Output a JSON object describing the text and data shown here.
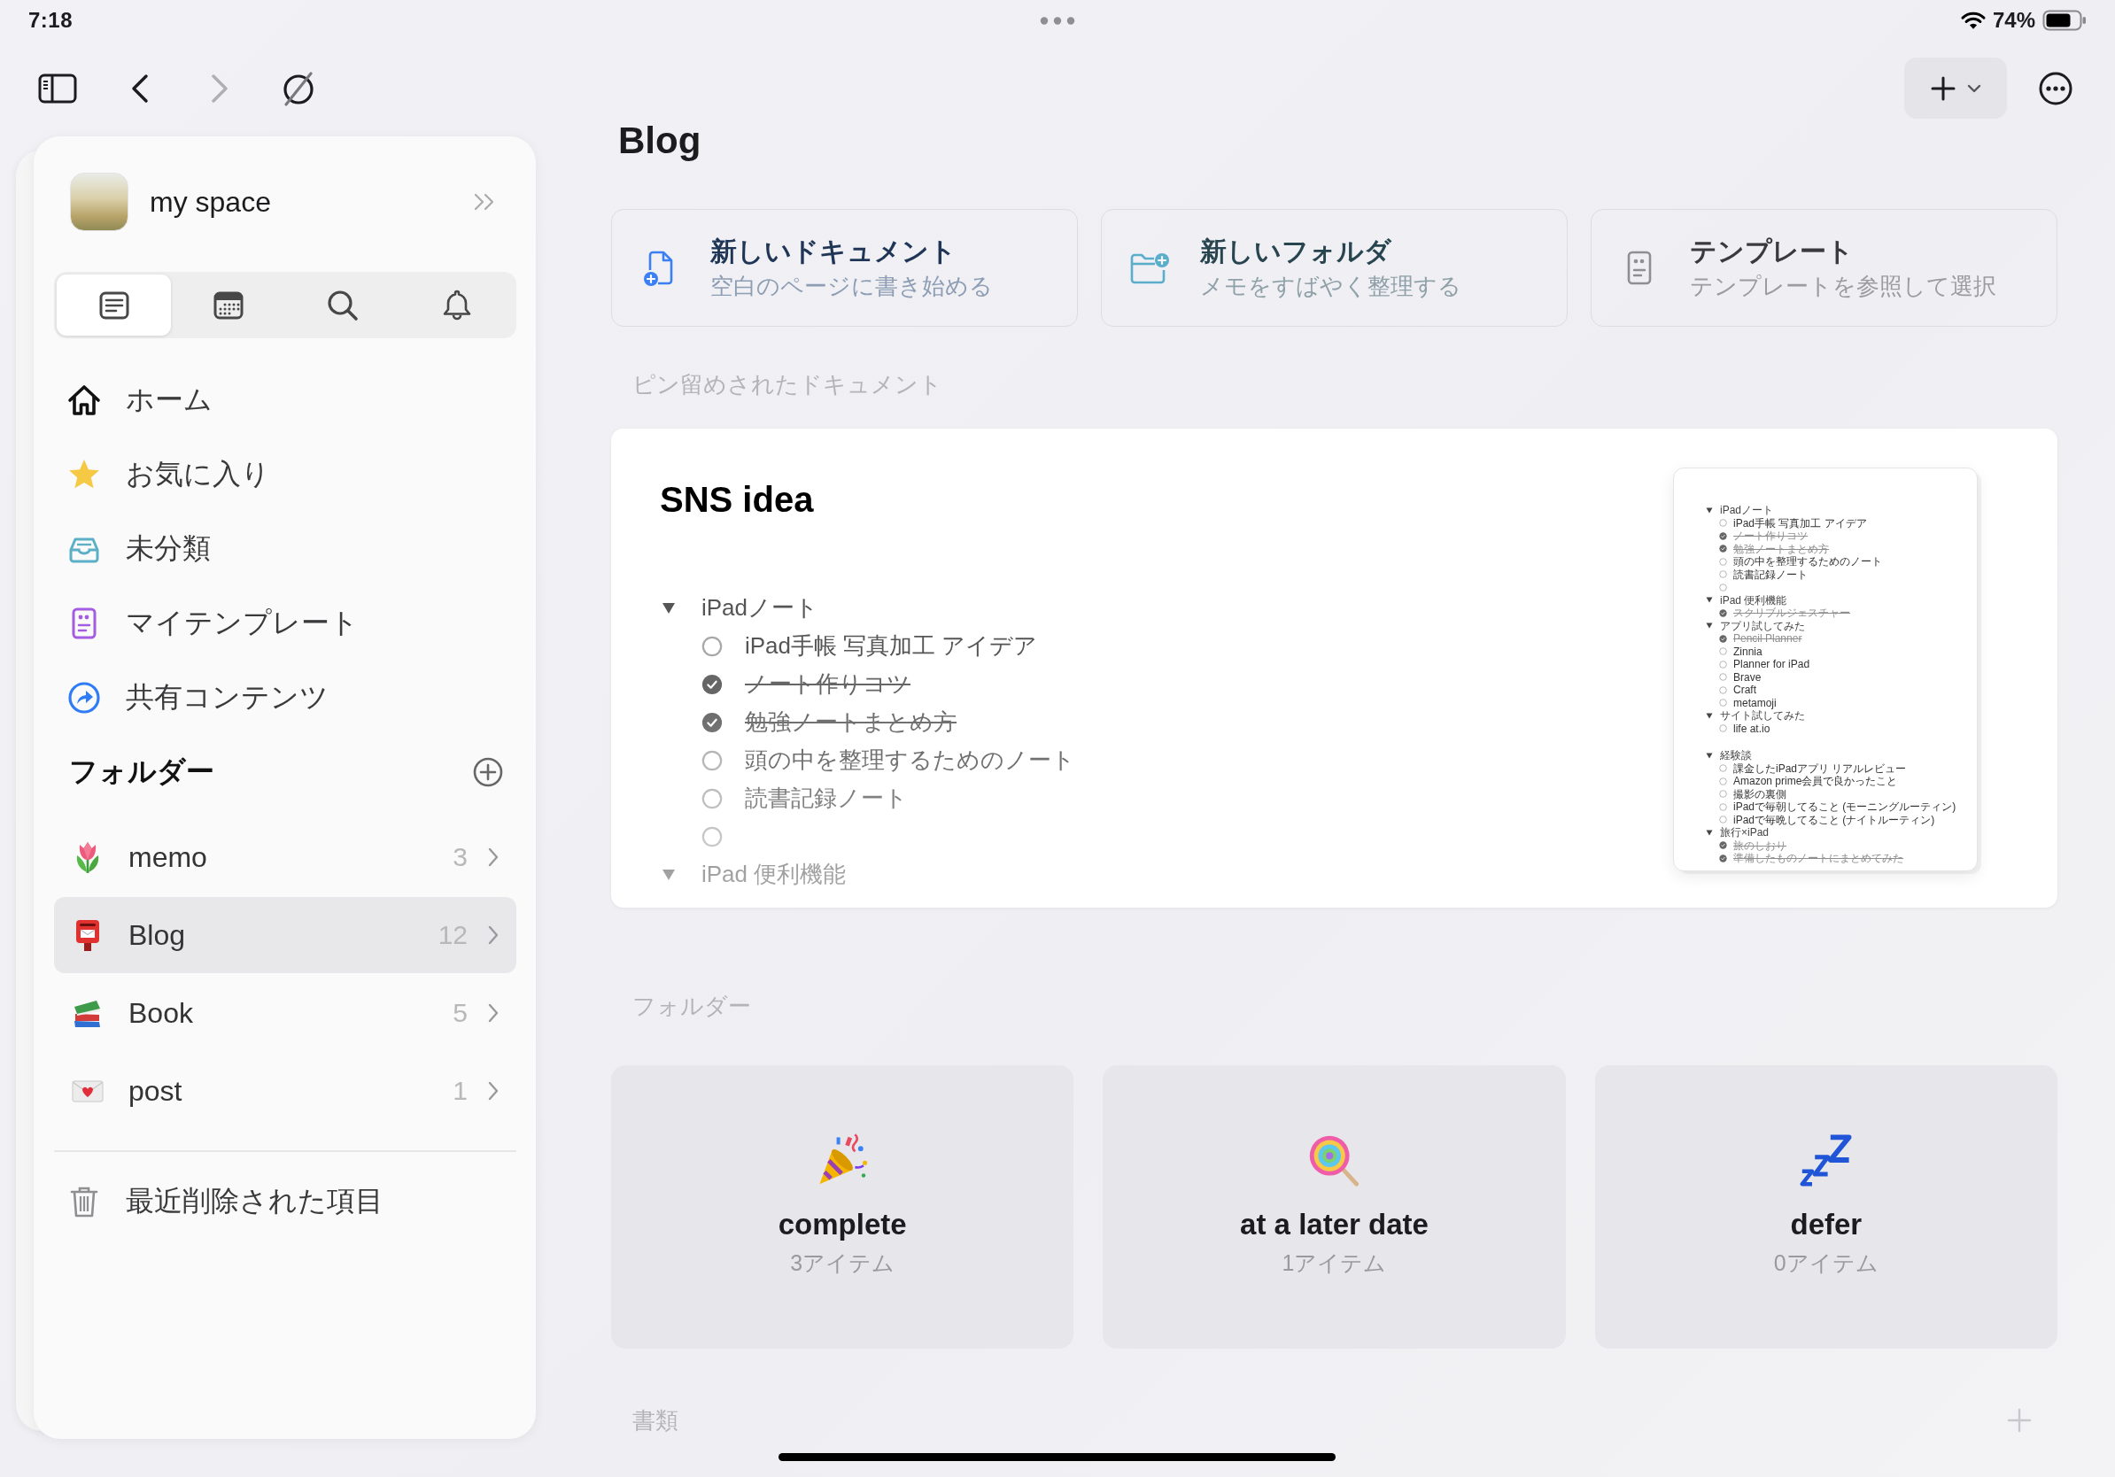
{
  "status_bar": {
    "time": "7:18",
    "battery": "74%"
  },
  "toolbar": {
    "back": {
      "disabled": false
    },
    "forward": {
      "disabled": true
    }
  },
  "sidebar": {
    "workspace": {
      "name": "my space"
    },
    "tabs": [
      {
        "selected": true
      },
      {
        "selected": false
      },
      {
        "selected": false
      },
      {
        "selected": false
      }
    ],
    "nav_items": [
      {
        "label": "ホーム",
        "selected": false
      },
      {
        "label": "お気に入り",
        "selected": false
      },
      {
        "label": "未分類",
        "selected": false
      },
      {
        "label": "マイテンプレート",
        "selected": false
      },
      {
        "label": "共有コンテンツ",
        "selected": false
      }
    ],
    "folders_heading": "フォルダー",
    "folders": [
      {
        "name": "memo",
        "count": "3",
        "selected": false
      },
      {
        "name": "Blog",
        "count": "12",
        "selected": true
      },
      {
        "name": "Book",
        "count": "5",
        "selected": false
      },
      {
        "name": "post",
        "count": "1",
        "selected": false
      }
    ],
    "trash": {
      "label": "最近削除された項目"
    }
  },
  "main": {
    "title": "Blog",
    "actions": [
      {
        "title": "新しいドキュメント",
        "subtitle": "空白のページに書き始める"
      },
      {
        "title": "新しいフォルダ",
        "subtitle": "メモをすばやく整理する"
      },
      {
        "title": "テンプレート",
        "subtitle": "テンプレートを参照して選択"
      }
    ],
    "pinned": {
      "label": "ピン留めされたドキュメント",
      "documents": [
        {
          "title": "SNS idea",
          "outline": [
            {
              "kind": "toggle",
              "text": "iPadノート",
              "expanded": true,
              "children": [
                {
                  "text": "iPad手帳 写真加工 アイデア",
                  "checked": false
                },
                {
                  "text": "ノート作りコツ",
                  "checked": true
                },
                {
                  "text": "勉強ノートまとめ方",
                  "checked": true
                },
                {
                  "text": "頭の中を整理するためのノート",
                  "checked": false
                },
                {
                  "text": "読書記録ノート",
                  "checked": false
                },
                {
                  "checked": false
                }
              ]
            },
            {
              "kind": "toggle",
              "text": "iPad 便利機能",
              "expanded": true
            }
          ],
          "preview": [
            {
              "kind": "toggle",
              "text": "iPadノート",
              "expanded": true,
              "children": [
                {
                  "text": "iPad手帳 写真加工 アイデア",
                  "checked": false
                },
                {
                  "text": "ノート作りコツ",
                  "checked": true
                },
                {
                  "text": "勉強ノートまとめ方",
                  "checked": true
                },
                {
                  "text": "頭の中を整理するためのノート",
                  "checked": false
                },
                {
                  "text": "読書記録ノート",
                  "checked": false
                },
                {
                  "checked": false
                }
              ]
            },
            {
              "kind": "toggle",
              "text": "iPad 便利機能",
              "expanded": true,
              "children": [
                {
                  "text": "スクリブルジェスチャー",
                  "checked": true
                }
              ]
            },
            {
              "kind": "toggle",
              "text": "アプリ試してみた",
              "expanded": true,
              "children": [
                {
                  "text": "Pencil Planner",
                  "checked": true
                },
                {
                  "text": "Zinnia",
                  "checked": false
                },
                {
                  "text": "Planner for iPad",
                  "checked": false
                },
                {
                  "text": "Brave",
                  "checked": false
                },
                {
                  "text": "Craft",
                  "checked": false
                },
                {
                  "text": "metamoji",
                  "checked": false
                }
              ]
            },
            {
              "kind": "toggle",
              "text": "サイト試してみた",
              "expanded": true,
              "children": [
                {
                  "text": "life at.io",
                  "checked": false
                }
              ]
            },
            {
              "kind": "blank"
            },
            {
              "kind": "toggle",
              "text": "経験談",
              "expanded": true,
              "children": [
                {
                  "text": "課金したiPadアプリ リアルレビュー",
                  "checked": false
                },
                {
                  "text": "Amazon prime会員で良かったこと",
                  "checked": false
                },
                {
                  "text": "撮影の裏側",
                  "checked": false
                },
                {
                  "text": "iPadで毎朝してること (モーニングルーティン)",
                  "checked": false
                },
                {
                  "text": "iPadで毎晩してること (ナイトルーティン)",
                  "checked": false
                }
              ]
            },
            {
              "kind": "toggle",
              "text": "旅行×iPad",
              "expanded": true,
              "children": [
                {
                  "text": "旅のしおり",
                  "checked": true
                },
                {
                  "text": "準備したものノートにまとめてみた",
                  "checked": true
                }
              ]
            }
          ]
        }
      ]
    },
    "folders": {
      "label": "フォルダー",
      "items": [
        {
          "name": "complete",
          "count": "3アイテム"
        },
        {
          "name": "at a later date",
          "count": "1アイテム"
        },
        {
          "name": "defer",
          "count": "0アイテム"
        }
      ]
    },
    "documents": {
      "label": "書類"
    }
  }
}
